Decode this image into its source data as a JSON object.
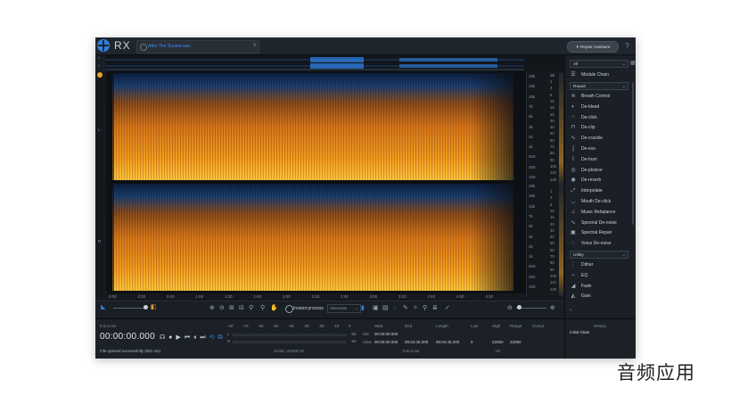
{
  "app": {
    "brand": "RX"
  },
  "tab": {
    "filename": "After The Sunset.wav",
    "close": "x"
  },
  "header": {
    "repair_assistant": "Repair Assistant",
    "help": "?"
  },
  "lanes": {
    "left": "L",
    "right": "R"
  },
  "timeline": [
    "0:00",
    "0:20",
    "0:40",
    "1:00",
    "1:20",
    "1:40",
    "2:00",
    "2:20",
    "2:40",
    "3:00",
    "3:20",
    "3:40",
    "4:00",
    "4:20"
  ],
  "freq_labels": [
    "20k",
    "15k",
    "10k",
    "7k",
    "5k",
    "3k",
    "2k",
    "1k",
    "500",
    "200",
    "100",
    "20k",
    "15k",
    "10k",
    "7k",
    "5k",
    "3k",
    "2k",
    "1k",
    "500",
    "200",
    "100"
  ],
  "db_labels": [
    "dB",
    "1",
    "3",
    "6",
    "10",
    "15",
    "20",
    "30",
    "40",
    "50",
    "60",
    "70",
    "80",
    "90",
    "100",
    "110",
    "120",
    "1",
    "3",
    "6",
    "10",
    "15",
    "20",
    "30",
    "40",
    "50",
    "60",
    "70",
    "80",
    "90",
    "100",
    "110",
    "120"
  ],
  "toolbar": {
    "instant_process": "Instant process",
    "mode": "Attenuate"
  },
  "sidebar": {
    "filter": "All",
    "module_chain": "Module Chain",
    "repair_group": "Repair",
    "repair_modules": [
      "Breath Control",
      "De-bleed",
      "De-click",
      "De-clip",
      "De-crackle",
      "De-ess",
      "De-hum",
      "De-plosive",
      "De-reverb",
      "Interpolate",
      "Mouth De-click",
      "Music Rebalance",
      "Spectral De-noise",
      "Spectral Repair",
      "Voice De-noise"
    ],
    "utility_group": "Utility",
    "utility_modules": [
      "Dither",
      "EQ",
      "Fade",
      "Gain"
    ]
  },
  "bottom": {
    "format": "h:m:s.ms",
    "timecode": "00:00:00.000",
    "status": "File opened successfully (881 ms)",
    "meter_scale": [
      "-Inf",
      "-70",
      "-60",
      "-50",
      "-40",
      "-30",
      "-20",
      "-10",
      "0"
    ],
    "ch_l": "L",
    "ch_r": "R",
    "peak_l": "-65",
    "peak_r": "-94",
    "bitdepth": "24-bit | 44100 Hz",
    "sel_label": "Sel",
    "view_label": "View",
    "start_label": "Start",
    "end_label": "End",
    "length_label": "Length",
    "low_label": "Low",
    "high_label": "High",
    "range_label": "Range",
    "cursor_label": "Cursor",
    "sel_start": "00:00:00.000",
    "view_start": "00:00:00.000",
    "view_end": "00:04:45.200",
    "view_length": "00:04:45.200",
    "view_low": "0",
    "view_high": "22050",
    "view_range": "22050",
    "unit_time": "h:m:s.ms",
    "unit_hz": "Hz",
    "history_title": "History",
    "history_item": "Initial State"
  },
  "watermark": "音频应用",
  "colors": {
    "accent": "#2f7fe0",
    "spectrum_hot": "#ffb020",
    "spectrum_cold": "#0e2a55"
  }
}
